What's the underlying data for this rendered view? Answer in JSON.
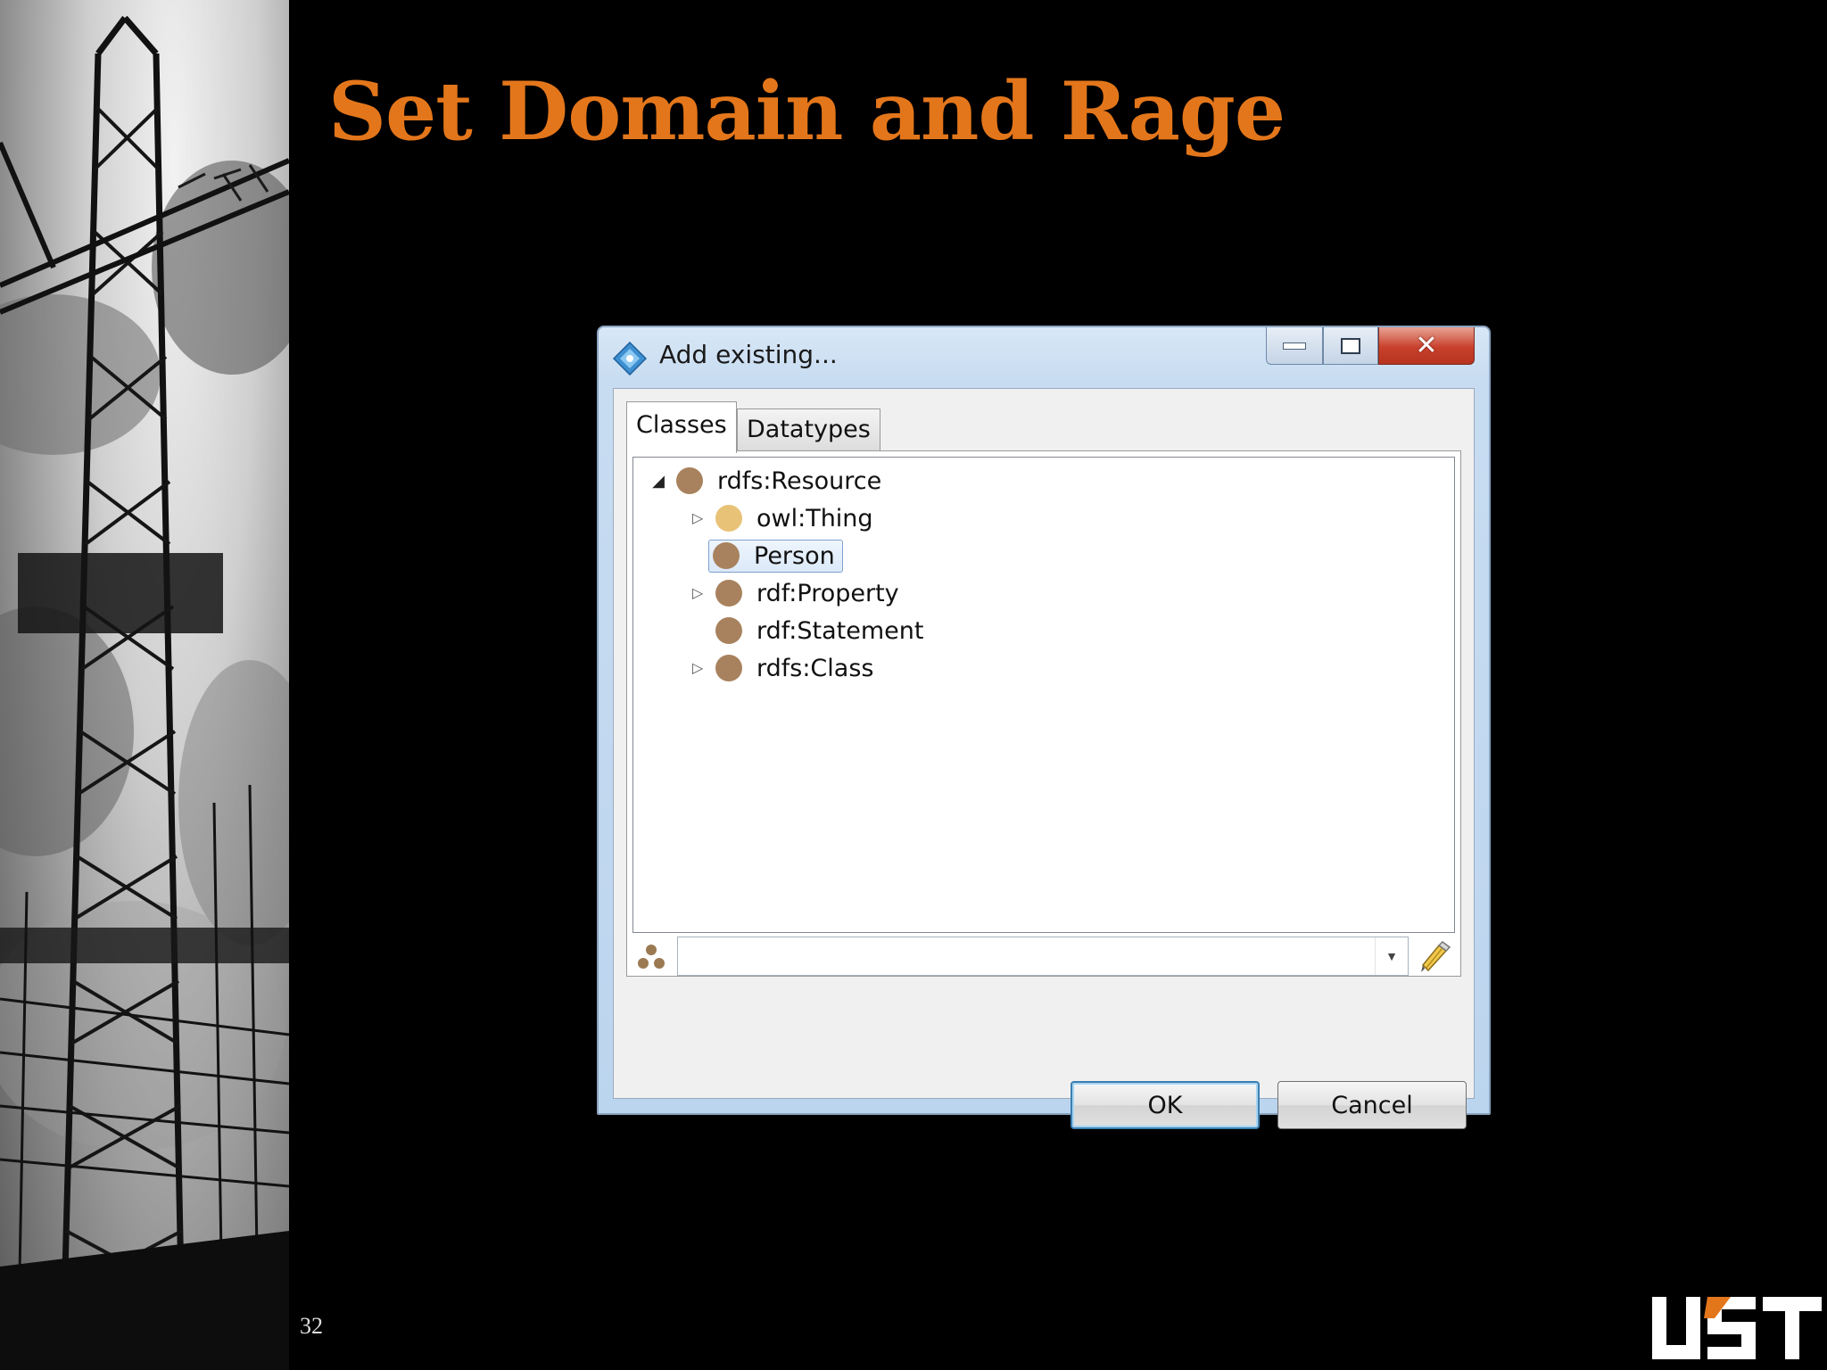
{
  "slide": {
    "title": "Set Domain and Rage",
    "page_number": "32",
    "logo_text": "UST",
    "title_color": "#e3761b"
  },
  "dialog": {
    "title": "Add existing...",
    "title_icon": "protege-diamond-icon",
    "window_buttons": [
      "minimize",
      "maximize",
      "close"
    ],
    "tabs": [
      {
        "label": "Classes",
        "active": true
      },
      {
        "label": "Datatypes",
        "active": false
      }
    ],
    "tree": [
      {
        "label": "rdfs:Resource",
        "level": 0,
        "expander": "expanded",
        "icon_color": "#a8825e"
      },
      {
        "label": "owl:Thing",
        "level": 1,
        "expander": "collapsed",
        "icon_color": "#e8c277"
      },
      {
        "label": "Person",
        "level": 1,
        "expander": "none",
        "icon_color": "#a8825e",
        "selected": true
      },
      {
        "label": "rdf:Property",
        "level": 1,
        "expander": "collapsed",
        "icon_color": "#a8825e"
      },
      {
        "label": "rdf:Statement",
        "level": 1,
        "expander": "none",
        "icon_color": "#a8825e"
      },
      {
        "label": "rdfs:Class",
        "level": 1,
        "expander": "collapsed",
        "icon_color": "#a8825e"
      }
    ],
    "filter": {
      "value": "",
      "placeholder": ""
    },
    "buttons": {
      "ok": "OK",
      "cancel": "Cancel"
    }
  }
}
